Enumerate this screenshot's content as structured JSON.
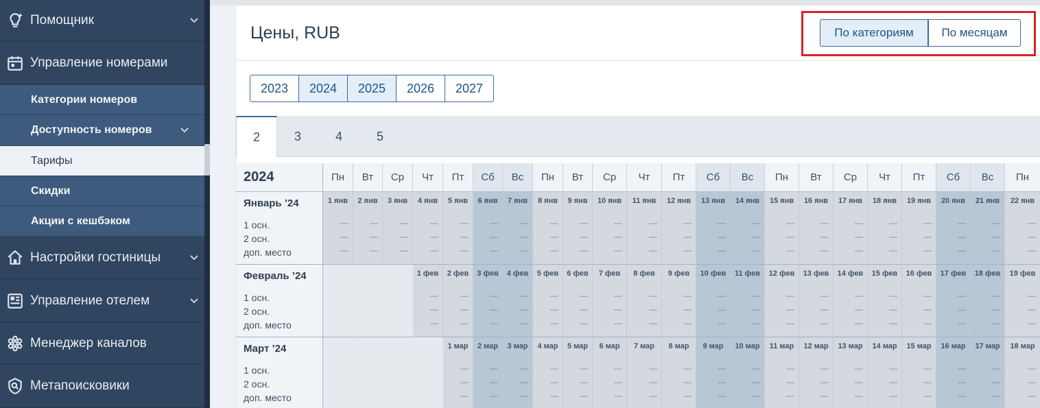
{
  "sidebar": {
    "items": [
      {
        "label": "Помощник",
        "icon": "lightbulb-icon"
      },
      {
        "label": "Управление номерами",
        "icon": "calendar-icon"
      },
      {
        "label": "Настройки гостиницы",
        "icon": "home-icon"
      },
      {
        "label": "Управление отелем",
        "icon": "dashboard-icon"
      },
      {
        "label": "Менеджер каналов",
        "icon": "channels-icon"
      },
      {
        "label": "Метапоисковики",
        "icon": "search-icon"
      }
    ],
    "subitems": [
      {
        "label": "Категории номеров"
      },
      {
        "label": "Доступность номеров"
      },
      {
        "label": "Тарифы",
        "active": true
      },
      {
        "label": "Скидки"
      },
      {
        "label": "Акции с кешбэком"
      }
    ]
  },
  "header": {
    "title": "Цены, RUB",
    "view_by_category": "По категориям",
    "view_by_month": "По месяцам"
  },
  "years": [
    "2023",
    "2024",
    "2025",
    "2026",
    "2027"
  ],
  "selected_years": [
    "2024",
    "2025"
  ],
  "tabs": [
    "2",
    "3",
    "4",
    "5"
  ],
  "active_tab": "2",
  "calendar": {
    "year": "2024",
    "weekdays": [
      "Пн",
      "Вт",
      "Ср",
      "Чт",
      "Пт",
      "Сб",
      "Вс",
      "Пн",
      "Вт",
      "Ср",
      "Чт",
      "Пт",
      "Сб",
      "Вс",
      "Пн",
      "Вт",
      "Ср",
      "Чт",
      "Пт",
      "Сб",
      "Вс",
      "Пн"
    ],
    "occupancy_labels": [
      "1 осн.",
      "2 осн.",
      "доп. место"
    ],
    "empty_value": "—",
    "months": [
      {
        "name": "Январь ’24",
        "offset": 0,
        "days": [
          "1 янв",
          "2 янв",
          "3 янв",
          "4 янв",
          "5 янв",
          "6 янв",
          "7 янв",
          "8 янв",
          "9 янв",
          "10 янв",
          "11 янв",
          "12 янв",
          "13 янв",
          "14 янв",
          "15 янв",
          "16 янв",
          "17 янв",
          "18 янв",
          "19 янв",
          "20 янв",
          "21 янв",
          "22 янв"
        ]
      },
      {
        "name": "Февраль ’24",
        "offset": 3,
        "days": [
          "1 фев",
          "2 фев",
          "3 фев",
          "4 фев",
          "5 фев",
          "6 фев",
          "7 фев",
          "8 фев",
          "9 фев",
          "10 фев",
          "11 фев",
          "12 фев",
          "13 фев",
          "14 фев",
          "15 фев",
          "16 фев",
          "17 фев",
          "18 фев",
          "19 фев"
        ]
      },
      {
        "name": "Март ’24",
        "offset": 4,
        "days": [
          "1 мар",
          "2 мар",
          "3 мар",
          "4 мар",
          "5 мар",
          "6 мар",
          "7 мар",
          "8 мар",
          "9 мар",
          "10 мар",
          "11 мар",
          "12 мар",
          "13 мар",
          "14 мар",
          "15 мар",
          "16 мар",
          "17 мар",
          "18 мар"
        ]
      }
    ]
  }
}
